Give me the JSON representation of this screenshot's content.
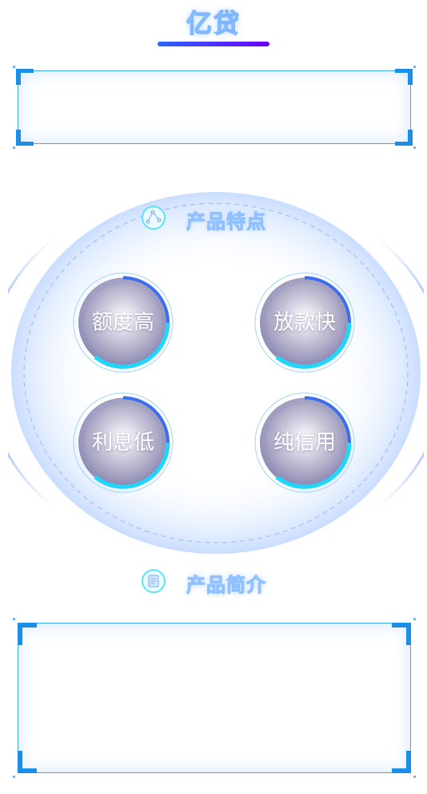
{
  "app": {
    "title": "亿贷"
  },
  "sections": {
    "features": {
      "title": "产品特点",
      "icon": "diagram-icon"
    },
    "intro": {
      "title": "产品简介",
      "icon": "document-icon"
    }
  },
  "features": [
    {
      "label": "额度高"
    },
    {
      "label": "放款快"
    },
    {
      "label": "利息低"
    },
    {
      "label": "纯信用"
    }
  ],
  "colors": {
    "accent": "#2b66ff",
    "accent2": "#6a00ff",
    "frame": "#3ea7e8",
    "cyan": "#1fd6ff"
  }
}
